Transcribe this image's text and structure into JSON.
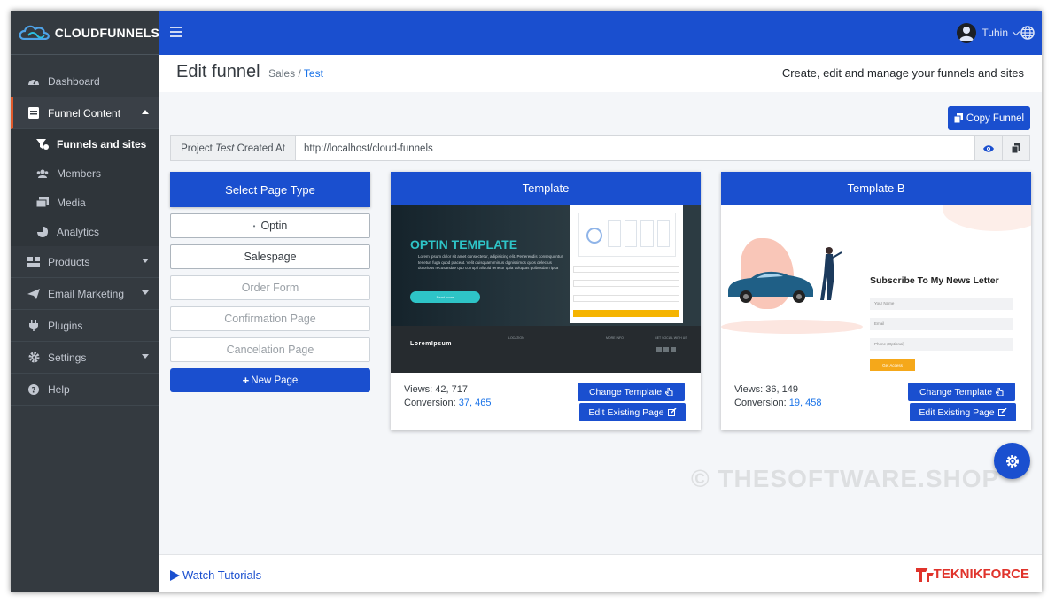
{
  "app": {
    "brand": "CLOUDFUNNELS",
    "user": "Tuhin",
    "colors": {
      "primary": "#1a4fcf",
      "sidebar": "#343a40",
      "active_border": "#e05a2b",
      "link": "#1a73e8"
    }
  },
  "sidebar": {
    "items": [
      {
        "label": "Dashboard",
        "icon": "dashboard-icon"
      },
      {
        "label": "Funnel Content",
        "icon": "funnel-content-icon"
      },
      {
        "label": "Funnels and sites",
        "icon": "funnels-icon"
      },
      {
        "label": "Members",
        "icon": "users-icon"
      },
      {
        "label": "Media",
        "icon": "media-icon"
      },
      {
        "label": "Analytics",
        "icon": "pie-chart-icon"
      },
      {
        "label": "Products",
        "icon": "products-icon"
      },
      {
        "label": "Email Marketing",
        "icon": "paper-plane-icon"
      },
      {
        "label": "Plugins",
        "icon": "plug-icon"
      },
      {
        "label": "Settings",
        "icon": "gear-icon"
      },
      {
        "label": "Help",
        "icon": "help-icon"
      }
    ]
  },
  "header": {
    "title": "Edit funnel",
    "crumb_a": "Sales",
    "crumb_sep": "/",
    "crumb_b": "Test",
    "tagline": "Create, edit and manage your funnels and sites"
  },
  "toolbar": {
    "copy_label": "Copy Funnel"
  },
  "project": {
    "label_pre": "Project",
    "label_name": "Test",
    "label_post": "Created At",
    "url": "http://localhost/cloud-funnels"
  },
  "page_types": {
    "title": "Select Page Type",
    "options": [
      {
        "label": "Optin"
      },
      {
        "label": "Salespage"
      },
      {
        "label": "Order Form"
      },
      {
        "label": "Confirmation Page"
      },
      {
        "label": "Cancelation Page"
      }
    ],
    "new_label": "New Page"
  },
  "cards": [
    {
      "title": "Template",
      "views_label": "Views:",
      "views": "42, 717",
      "conv_label": "Conversion:",
      "conv": "37, 465",
      "change_label": "Change Template",
      "edit_label": "Edit Existing Page",
      "preview": {
        "heading": "OPTIN TEMPLATE",
        "body": "Lorem ipsum dolor sit amet consectetur, adipisicing elit. Perferendis consequuntur tenetur, fuga quod placeat. Velit quisquam minus dignissimos quos delectus dolorious recusandae quo corrupti aliquid tenetur quia voluptas quibusdam ipsa",
        "cta": "Read more",
        "brand": "LoremIpsum",
        "col_location": "LOCATION",
        "col_more": "MORE INFO",
        "col_social": "GET SOCIAL WITH US"
      }
    },
    {
      "title": "Template B",
      "views_label": "Views:",
      "views": "36, 149",
      "conv_label": "Conversion:",
      "conv": "19, 458",
      "change_label": "Change Template",
      "edit_label": "Edit Existing Page",
      "preview": {
        "heading": "Subscribe To My News Letter",
        "field1": "Your Name",
        "field2": "Email",
        "field3": "Phone (Optional)",
        "button": "Get Access"
      }
    }
  ],
  "watermark": "© THESOFTWARE.SHOP",
  "footer": {
    "tutorials": "Watch Tutorials",
    "logo": "TEKNIKFORCE"
  }
}
